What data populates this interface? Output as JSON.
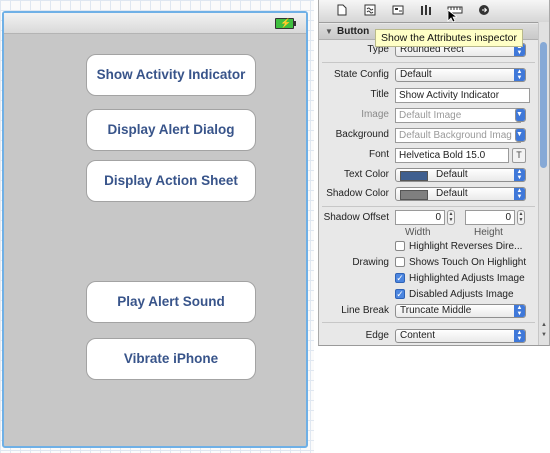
{
  "canvas": {
    "buttons": [
      "Show Activity Indicator",
      "Display Alert Dialog",
      "Display Action Sheet",
      "Play Alert Sound",
      "Vibrate iPhone"
    ]
  },
  "inspector": {
    "tooltip": "Show the Attributes inspector",
    "section_title": "Button",
    "rows": {
      "type": {
        "label": "Type",
        "value": "Rounded Rect"
      },
      "state_config": {
        "label": "State Config",
        "value": "Default"
      },
      "title": {
        "label": "Title",
        "value": "Show Activity Indicator"
      },
      "image": {
        "label": "Image",
        "placeholder": "Default Image"
      },
      "background": {
        "label": "Background",
        "placeholder": "Default Background Imag"
      },
      "font": {
        "label": "Font",
        "value": "Helvetica Bold 15.0"
      },
      "text_color": {
        "label": "Text Color",
        "value": "Default",
        "swatch": "#3f5f8f"
      },
      "shadow_color": {
        "label": "Shadow Color",
        "value": "Default",
        "swatch": "#7f7f7f"
      },
      "shadow_offset": {
        "label": "Shadow Offset",
        "width": "0",
        "height": "0",
        "width_label": "Width",
        "height_label": "Height"
      },
      "highlight_reverses": {
        "label": "Highlight Reverses Dire...",
        "checked": false
      },
      "drawing": {
        "label": "Drawing"
      },
      "shows_touch": {
        "label": "Shows Touch On Highlight",
        "checked": false
      },
      "highlighted_adjusts": {
        "label": "Highlighted Adjusts Image",
        "checked": true
      },
      "disabled_adjusts": {
        "label": "Disabled Adjusts Image",
        "checked": true
      },
      "line_break": {
        "label": "Line Break",
        "value": "Truncate Middle"
      },
      "edge": {
        "label": "Edge",
        "value": "Content"
      }
    },
    "toolbar_icons": [
      "file-icon",
      "quick-help-icon",
      "identity-icon",
      "attributes-icon",
      "size-icon",
      "connections-icon"
    ]
  }
}
